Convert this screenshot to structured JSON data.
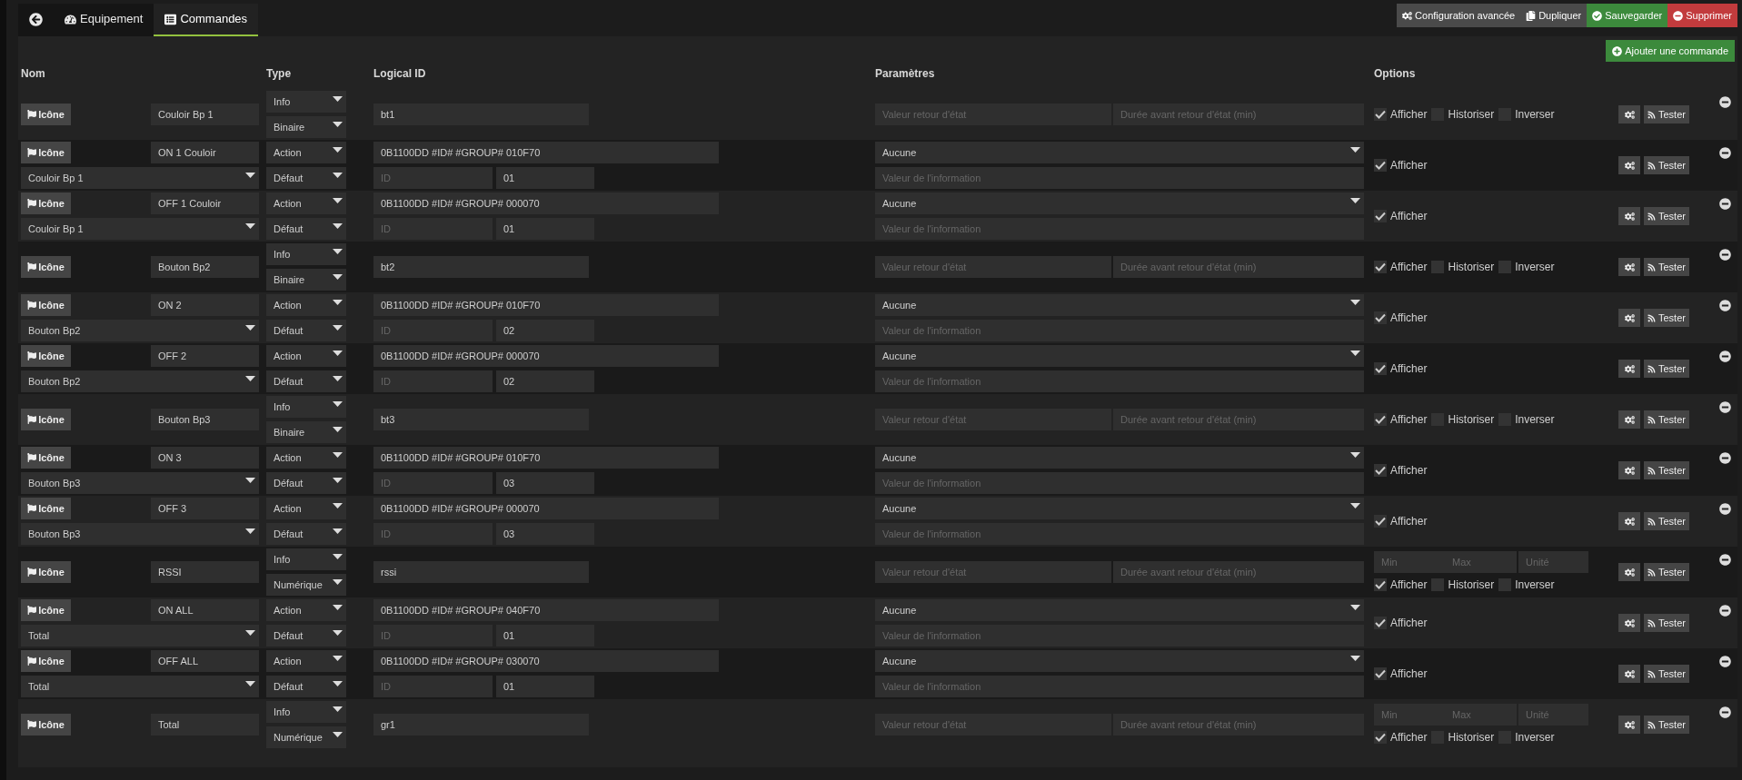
{
  "tabs": [
    {
      "kind": "back",
      "selected": false
    },
    {
      "kind": "equipment",
      "label": "Equipement",
      "selected": false
    },
    {
      "kind": "commands",
      "label": "Commandes",
      "selected": true
    }
  ],
  "header_buttons": [
    {
      "kind": "advanced",
      "label": "Configuration avancée"
    },
    {
      "kind": "duplicate",
      "label": "Dupliquer"
    },
    {
      "kind": "save",
      "label": "Sauvegarder"
    },
    {
      "kind": "delete",
      "label": "Supprimer"
    }
  ],
  "add_button": "Ajouter une commande",
  "columns": [
    "Nom",
    "Type",
    "Logical ID",
    "Paramètres",
    "Options"
  ],
  "commands": [
    {
      "kind": "info",
      "icon_label": "Icône",
      "name": "Couloir Bp 1",
      "type": "Info",
      "subtype": "Binaire",
      "logical_id": "bt1",
      "return_value_placeholder": "Valeur retour d'état",
      "return_delay_placeholder": "Durée avant retour d'état (min)",
      "options": [
        {
          "label": "Afficher",
          "checked": true
        },
        {
          "label": "Historiser",
          "checked": false
        },
        {
          "label": "Inverser",
          "checked": false
        }
      ],
      "test_label": "Tester"
    },
    {
      "kind": "action",
      "icon_label": "Icône",
      "name": "ON 1 Couloir",
      "linked_info": "Couloir Bp 1",
      "type": "Action",
      "subtype": "Défaut",
      "logical_id": "0B1100DD #ID# #GROUP# 010F70",
      "id_placeholder": "ID",
      "id_value": "01",
      "value_select": "Aucune",
      "info_value_placeholder": "Valeur de l'information",
      "options": [
        {
          "label": "Afficher",
          "checked": true
        }
      ],
      "test_label": "Tester"
    },
    {
      "kind": "action",
      "icon_label": "Icône",
      "name": "OFF 1 Couloir",
      "linked_info": "Couloir Bp 1",
      "type": "Action",
      "subtype": "Défaut",
      "logical_id": "0B1100DD #ID# #GROUP# 000070",
      "id_placeholder": "ID",
      "id_value": "01",
      "value_select": "Aucune",
      "info_value_placeholder": "Valeur de l'information",
      "options": [
        {
          "label": "Afficher",
          "checked": true
        }
      ],
      "test_label": "Tester"
    },
    {
      "kind": "info",
      "icon_label": "Icône",
      "name": "Bouton Bp2",
      "type": "Info",
      "subtype": "Binaire",
      "logical_id": "bt2",
      "return_value_placeholder": "Valeur retour d'état",
      "return_delay_placeholder": "Durée avant retour d'état (min)",
      "options": [
        {
          "label": "Afficher",
          "checked": true
        },
        {
          "label": "Historiser",
          "checked": false
        },
        {
          "label": "Inverser",
          "checked": false
        }
      ],
      "test_label": "Tester"
    },
    {
      "kind": "action",
      "icon_label": "Icône",
      "name": "ON 2",
      "linked_info": "Bouton Bp2",
      "type": "Action",
      "subtype": "Défaut",
      "logical_id": "0B1100DD #ID# #GROUP# 010F70",
      "id_placeholder": "ID",
      "id_value": "02",
      "value_select": "Aucune",
      "info_value_placeholder": "Valeur de l'information",
      "options": [
        {
          "label": "Afficher",
          "checked": true
        }
      ],
      "test_label": "Tester"
    },
    {
      "kind": "action",
      "icon_label": "Icône",
      "name": "OFF 2",
      "linked_info": "Bouton Bp2",
      "type": "Action",
      "subtype": "Défaut",
      "logical_id": "0B1100DD #ID# #GROUP# 000070",
      "id_placeholder": "ID",
      "id_value": "02",
      "value_select": "Aucune",
      "info_value_placeholder": "Valeur de l'information",
      "options": [
        {
          "label": "Afficher",
          "checked": true
        }
      ],
      "test_label": "Tester"
    },
    {
      "kind": "info",
      "icon_label": "Icône",
      "name": "Bouton Bp3",
      "type": "Info",
      "subtype": "Binaire",
      "logical_id": "bt3",
      "return_value_placeholder": "Valeur retour d'état",
      "return_delay_placeholder": "Durée avant retour d'état (min)",
      "options": [
        {
          "label": "Afficher",
          "checked": true
        },
        {
          "label": "Historiser",
          "checked": false
        },
        {
          "label": "Inverser",
          "checked": false
        }
      ],
      "test_label": "Tester"
    },
    {
      "kind": "action",
      "icon_label": "Icône",
      "name": "ON 3",
      "linked_info": "Bouton Bp3",
      "type": "Action",
      "subtype": "Défaut",
      "logical_id": "0B1100DD #ID# #GROUP# 010F70",
      "id_placeholder": "ID",
      "id_value": "03",
      "value_select": "Aucune",
      "info_value_placeholder": "Valeur de l'information",
      "options": [
        {
          "label": "Afficher",
          "checked": true
        }
      ],
      "test_label": "Tester"
    },
    {
      "kind": "action",
      "icon_label": "Icône",
      "name": "OFF 3",
      "linked_info": "Bouton Bp3",
      "type": "Action",
      "subtype": "Défaut",
      "logical_id": "0B1100DD #ID# #GROUP# 000070",
      "id_placeholder": "ID",
      "id_value": "03",
      "value_select": "Aucune",
      "info_value_placeholder": "Valeur de l'information",
      "options": [
        {
          "label": "Afficher",
          "checked": true
        }
      ],
      "test_label": "Tester"
    },
    {
      "kind": "info",
      "icon_label": "Icône",
      "name": "RSSI",
      "type": "Info",
      "subtype": "Numérique",
      "logical_id": "rssi",
      "return_value_placeholder": "Valeur retour d'état",
      "return_delay_placeholder": "Durée avant retour d'état (min)",
      "min_placeholder": "Min",
      "max_placeholder": "Max",
      "unit_placeholder": "Unité",
      "options": [
        {
          "label": "Afficher",
          "checked": true
        },
        {
          "label": "Historiser",
          "checked": false
        },
        {
          "label": "Inverser",
          "checked": false
        }
      ],
      "test_label": "Tester"
    },
    {
      "kind": "action",
      "icon_label": "Icône",
      "name": "ON ALL",
      "linked_info": "Total",
      "type": "Action",
      "subtype": "Défaut",
      "logical_id": "0B1100DD #ID# #GROUP# 040F70",
      "id_placeholder": "ID",
      "id_value": "01",
      "value_select": "Aucune",
      "info_value_placeholder": "Valeur de l'information",
      "options": [
        {
          "label": "Afficher",
          "checked": true
        }
      ],
      "test_label": "Tester"
    },
    {
      "kind": "action",
      "icon_label": "Icône",
      "name": "OFF ALL",
      "linked_info": "Total",
      "type": "Action",
      "subtype": "Défaut",
      "logical_id": "0B1100DD #ID# #GROUP# 030070",
      "id_placeholder": "ID",
      "id_value": "01",
      "value_select": "Aucune",
      "info_value_placeholder": "Valeur de l'information",
      "options": [
        {
          "label": "Afficher",
          "checked": true
        }
      ],
      "test_label": "Tester"
    },
    {
      "kind": "info",
      "icon_label": "Icône",
      "name": "Total",
      "type": "Info",
      "subtype": "Numérique",
      "logical_id": "gr1",
      "return_value_placeholder": "Valeur retour d'état",
      "return_delay_placeholder": "Durée avant retour d'état (min)",
      "min_placeholder": "Min",
      "max_placeholder": "Max",
      "unit_placeholder": "Unité",
      "options": [
        {
          "label": "Afficher",
          "checked": true
        },
        {
          "label": "Historiser",
          "checked": false
        },
        {
          "label": "Inverser",
          "checked": false
        }
      ],
      "test_label": "Tester"
    }
  ]
}
